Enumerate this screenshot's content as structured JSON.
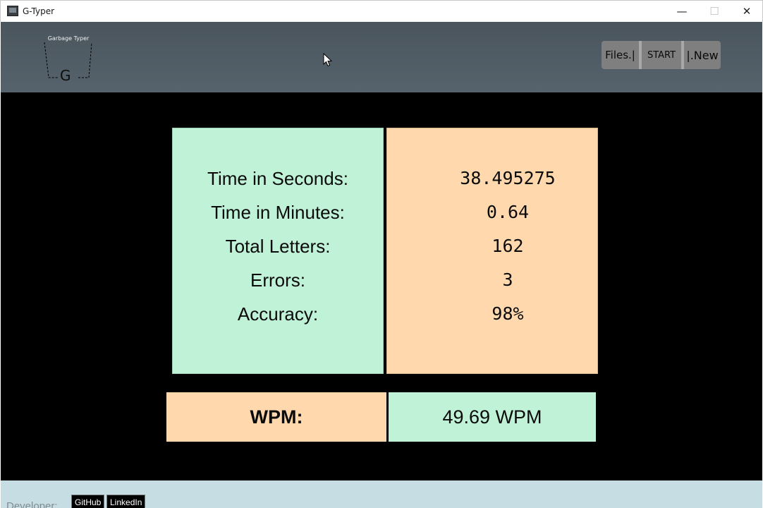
{
  "window": {
    "title": "G-Typer",
    "controls": {
      "minimize": "—",
      "maximize": "☐",
      "close": "✕"
    }
  },
  "header": {
    "logo_text": "Garbage Typer",
    "logo_letter": "G",
    "buttons": {
      "files": "Files.|",
      "start": "START",
      "new": "|.New"
    }
  },
  "results": {
    "labels": [
      "Time in Seconds:",
      "Time in Minutes:",
      "Total Letters:",
      "Errors:",
      "Accuracy:"
    ],
    "values": [
      "38.495275",
      "0.64",
      "162",
      "3",
      "98%"
    ]
  },
  "wpm": {
    "label": "WPM:",
    "value": "49.69 WPM"
  },
  "footer": {
    "developer_label": "Developer:",
    "github": "GitHub",
    "linkedin": "LinkedIn"
  },
  "colors": {
    "header_bg": "#4f5b63",
    "main_bg": "#000000",
    "green_panel": "#bff2d7",
    "orange_panel": "#ffd9ad",
    "footer_bg": "#c6dde3",
    "button_bg": "#7f7f7f"
  }
}
